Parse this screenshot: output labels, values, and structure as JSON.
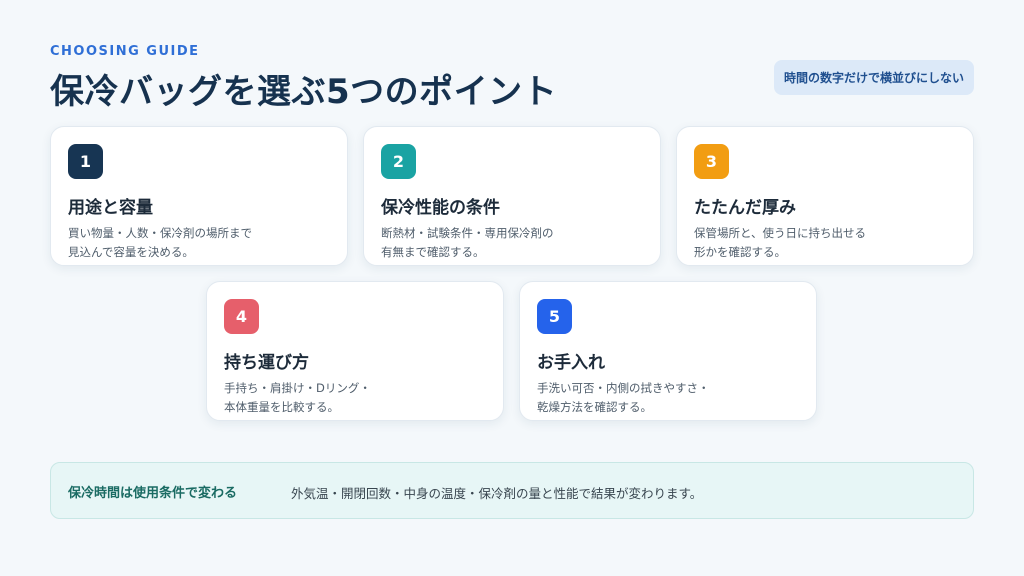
{
  "header": {
    "eyebrow": "CHOOSING GUIDE",
    "title": "保冷バッグを選ぶ5つのポイント",
    "note": "時間の数字だけで横並びにしない"
  },
  "cards": [
    {
      "number": "1",
      "color": "#173553",
      "title": "用途と容量",
      "desc_line1": "買い物量・人数・保冷剤の場所まで",
      "desc_line2": "見込んで容量を決める。"
    },
    {
      "number": "2",
      "color": "#1aa3a3",
      "title": "保冷性能の条件",
      "desc_line1": "断熱材・試験条件・専用保冷剤の",
      "desc_line2": "有無まで確認する。"
    },
    {
      "number": "3",
      "color": "#f29d12",
      "title": "たたんだ厚み",
      "desc_line1": "保管場所と、使う日に持ち出せる",
      "desc_line2": "形かを確認する。"
    },
    {
      "number": "4",
      "color": "#e65f6b",
      "title": "持ち運び方",
      "desc_line1": "手持ち・肩掛け・Dリング・",
      "desc_line2": "本体重量を比較する。"
    },
    {
      "number": "5",
      "color": "#2563eb",
      "title": "お手入れ",
      "desc_line1": "手洗い可否・内側の拭きやすさ・",
      "desc_line2": "乾燥方法を確認する。"
    }
  ],
  "footer": {
    "title": "保冷時間は使用条件で変わる",
    "text": "外気温・開閉回数・中身の温度・保冷剤の量と性能で結果が変わります。"
  }
}
